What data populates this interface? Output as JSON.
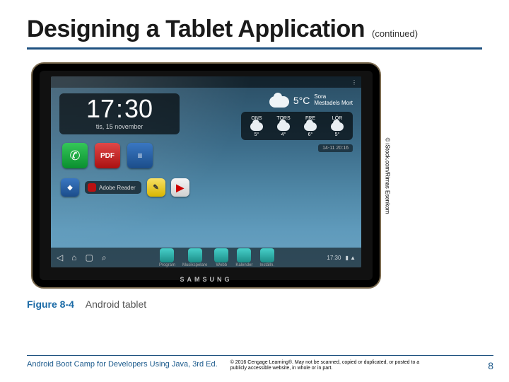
{
  "header": {
    "title": "Designing a Tablet Application",
    "continued": "(continued)"
  },
  "tablet": {
    "brand": "SAMSUNG",
    "topbar": {
      "left_icons": "",
      "right_icons": "⋮"
    },
    "clock": {
      "hour": "17",
      "sep": ":",
      "minute": "30",
      "date": "tis, 15 november"
    },
    "row1_icons": [
      "phone-icon",
      "pdf-icon",
      "reader-icon"
    ],
    "row2": {
      "pill1": "Adobe Reader",
      "icons": [
        "notes-icon",
        "youtube-icon"
      ]
    },
    "weather": {
      "temp": "5°C",
      "place": "Sora",
      "cond": "Mestadels Mort",
      "days": [
        {
          "d": "ONS",
          "t": "5°"
        },
        {
          "d": "TORS",
          "t": "4°"
        },
        {
          "d": "FRE",
          "t": "6°"
        },
        {
          "d": "LÖR",
          "t": "5°"
        }
      ],
      "date_strip": "14-11 20:16"
    },
    "dock": {
      "nav": [
        "◁",
        "⌂",
        "▢",
        "⌕"
      ],
      "apps": [
        {
          "label": "Program"
        },
        {
          "label": "Musikspelare"
        },
        {
          "label": "Webb"
        },
        {
          "label": "Kalender"
        },
        {
          "label": "Inställn."
        }
      ],
      "status_time": "17:30",
      "status_icons": "▮ ▲"
    }
  },
  "figure": {
    "credit": "© iStock.com/Rimas Esenkom",
    "label": "Figure 8-4",
    "text": "Android tablet"
  },
  "footer": {
    "book": "Android Boot Camp for Developers Using Java, 3rd Ed.",
    "copyright": "© 2016 Cengage Learning®. May not be scanned, copied or duplicated, or posted to a publicly accessible website, in whole or in part.",
    "page": "8"
  }
}
